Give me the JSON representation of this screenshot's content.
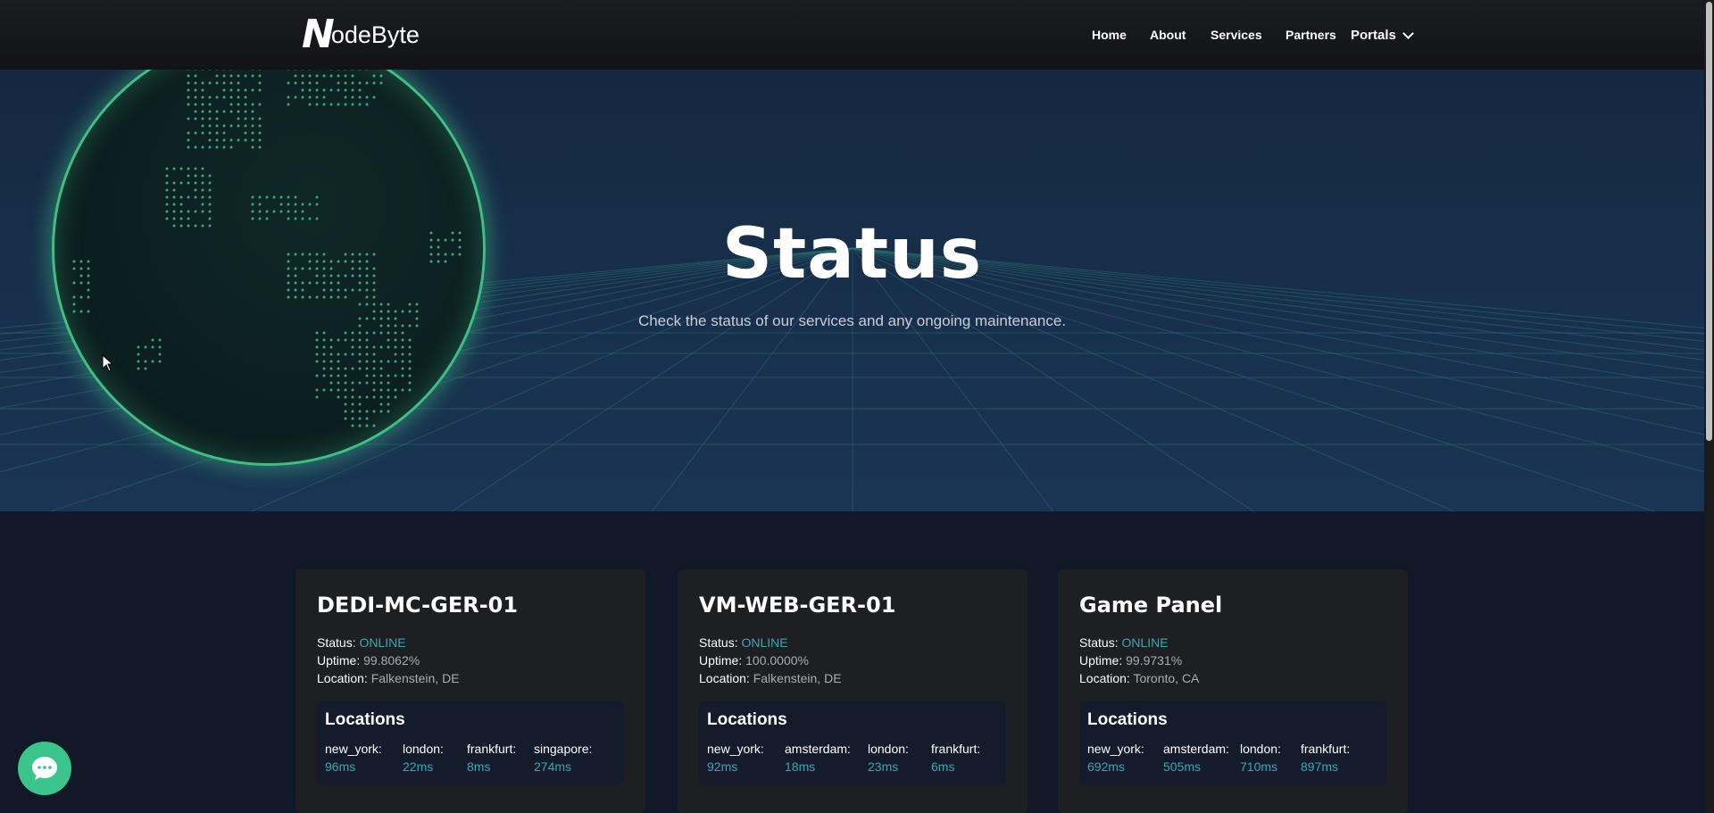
{
  "nav": {
    "logo_initial": "N",
    "logo_text": "odeByte",
    "links": [
      "Home",
      "About",
      "Services",
      "Partners"
    ],
    "portals_label": "Portals"
  },
  "hero": {
    "title": "Status",
    "subtitle": "Check the status of our services and any ongoing maintenance."
  },
  "labels": {
    "status": "Status:",
    "uptime": "Uptime:",
    "location": "Location:",
    "locations_title": "Locations"
  },
  "cards": [
    {
      "name": "DEDI-MC-GER-01",
      "status": "ONLINE",
      "uptime": "99.8062%",
      "location": "Falkenstein, DE",
      "pings": [
        {
          "city": "new_york:",
          "ms": "96"
        },
        {
          "city": "london:",
          "ms": "22"
        },
        {
          "city": "frankfurt:",
          "ms": "8"
        },
        {
          "city": "singapore:",
          "ms": "274"
        }
      ]
    },
    {
      "name": "VM-WEB-GER-01",
      "status": "ONLINE",
      "uptime": "100.0000%",
      "location": "Falkenstein, DE",
      "pings": [
        {
          "city": "new_york:",
          "ms": "92"
        },
        {
          "city": "amsterdam:",
          "ms": "18"
        },
        {
          "city": "london:",
          "ms": "23"
        },
        {
          "city": "frankfurt:",
          "ms": "6"
        }
      ]
    },
    {
      "name": "Game Panel",
      "status": "ONLINE",
      "uptime": "99.9731%",
      "location": "Toronto, CA",
      "pings": [
        {
          "city": "new_york:",
          "ms": "692"
        },
        {
          "city": "amsterdam:",
          "ms": "505"
        },
        {
          "city": "london:",
          "ms": "710"
        },
        {
          "city": "frankfurt:",
          "ms": "897"
        }
      ]
    }
  ],
  "ms_unit": "ms",
  "colors": {
    "accent": "#3ba7b5",
    "globe_glow": "#3fbf86",
    "chat": "#3bc48b",
    "card_bg": "#1e1f22",
    "page_bg": "#111827"
  },
  "icons": {
    "chat": "chat-bubble-icon",
    "portals": "chevron-down-icon",
    "cursor": "mouse-pointer-icon"
  }
}
